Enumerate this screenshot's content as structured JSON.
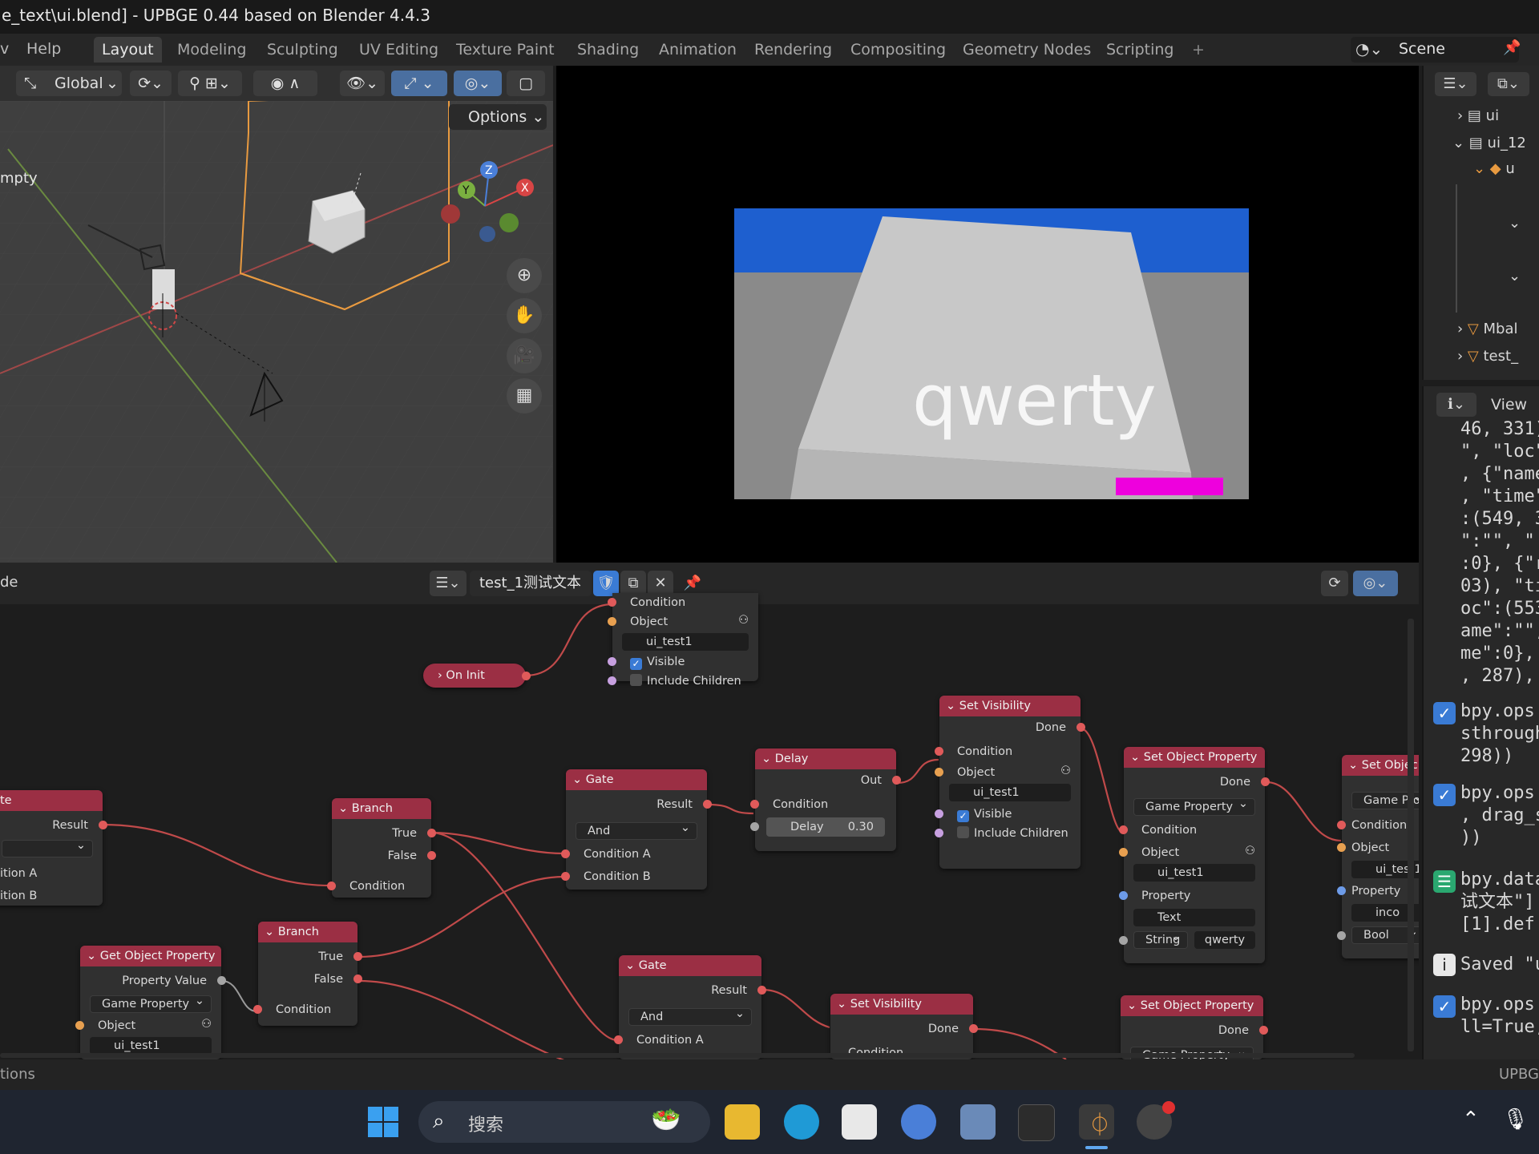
{
  "window": {
    "title": "e_text\\ui.blend] - UPBGE 0.44 based on Blender 4.4.3"
  },
  "menu": {
    "left_partial": "v",
    "help": "Help"
  },
  "workspaces": [
    "Layout",
    "Modeling",
    "Sculpting",
    "UV Editing",
    "Texture Paint",
    "Shading",
    "Animation",
    "Rendering",
    "Compositing",
    "Geometry Nodes",
    "Scripting"
  ],
  "add_workspace": "+",
  "scene": {
    "label": "Scene"
  },
  "viewport": {
    "transform_orientation": "Global",
    "options_label": "Options",
    "empty_label": "mpty",
    "gizmo": {
      "x": "X",
      "y": "Y",
      "z": "Z"
    }
  },
  "game": {
    "overlay_text": "qwerty"
  },
  "outliner": {
    "items": [
      "ui",
      "ui_12",
      "u",
      "Mbal",
      "test_"
    ]
  },
  "info_panel": {
    "view_label": "View",
    "text_block": "46, 331)\n\", \"loc\"\n, {\"name\n, \"time\"\n:(549, 3\n\":\"\", \"\n:0}, {\"r\n03), \"ti\noc\":(553\name\":\"\",\nme\":0},\n, 287),",
    "log": [
      {
        "type": "check",
        "text": "bpy.ops.\nsthrough\n298))"
      },
      {
        "type": "check",
        "text": "bpy.ops.\n, drag_s\n))"
      },
      {
        "type": "data",
        "text": "bpy.data\n试文本\"]\n[1].def"
      },
      {
        "type": "info",
        "text": "Saved \"u"
      },
      {
        "type": "check",
        "text": "bpy.ops.\nll=True,"
      }
    ]
  },
  "node_editor": {
    "left_label": "de",
    "tree_name": "test_1测试文本",
    "nodes": {
      "top_vis": {
        "condition": "Condition",
        "object": "Object",
        "object_value": "ui_test1",
        "visible": "Visible",
        "include_children": "Include Children"
      },
      "on_init": {
        "title": "On Init"
      },
      "set_vis1": {
        "title": "Set Visibility",
        "done": "Done",
        "condition": "Condition",
        "object": "Object",
        "object_value": "ui_test1",
        "visible": "Visible",
        "include_children": "Include Children"
      },
      "delay": {
        "title": "Delay",
        "out": "Out",
        "condition": "Condition",
        "delay_label": "Delay",
        "delay_value": "0.30"
      },
      "gate1": {
        "title": "Gate",
        "result": "Result",
        "op": "And",
        "cond_a": "Condition A",
        "cond_b": "Condition B"
      },
      "branch1": {
        "title": "Branch",
        "true": "True",
        "false": "False",
        "condition": "Condition"
      },
      "left_partial": {
        "title": "te",
        "result": "Result",
        "cond_a": "ition A",
        "cond_b": "ition B"
      },
      "branch2": {
        "title": "Branch",
        "true": "True",
        "false": "False",
        "condition": "Condition"
      },
      "get_prop": {
        "title": "Get Object Property",
        "value": "Property Value",
        "mode": "Game Property",
        "object": "Object",
        "object_value": "ui_test1"
      },
      "gate2": {
        "title": "Gate",
        "result": "Result",
        "op": "And",
        "cond_a": "Condition A"
      },
      "set_vis2": {
        "title": "Set Visibility",
        "done": "Done",
        "condition": "Condition"
      },
      "set_prop1": {
        "title": "Set Object Property",
        "done": "Done",
        "mode": "Game Property",
        "condition": "Condition",
        "object": "Object",
        "object_value": "ui_test1",
        "property": "Property",
        "property_value": "Text",
        "type": "String",
        "value": "qwerty"
      },
      "set_prop2": {
        "title": "Set Object Property",
        "done": "Done",
        "mode": "Game Property"
      },
      "set_prop3": {
        "title": "Set Objec",
        "mode": "Game Prop",
        "condition": "Condition",
        "object": "Object",
        "object_value": "ui_test1",
        "property": "Property",
        "property_value": "inco",
        "type": "Bool"
      }
    }
  },
  "statusbar": {
    "left": "tions",
    "right": "UPBG"
  },
  "taskbar": {
    "search_placeholder": "搜索"
  }
}
